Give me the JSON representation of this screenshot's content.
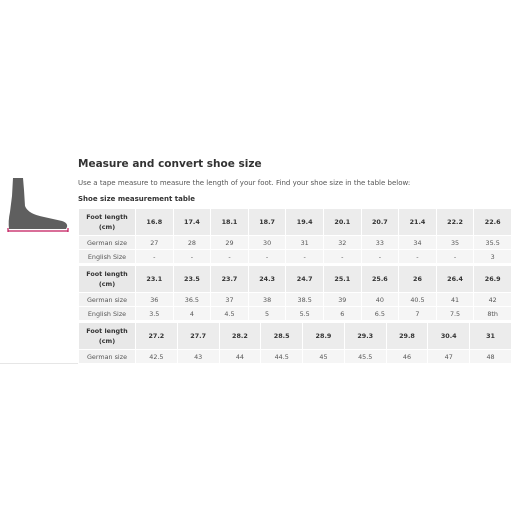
{
  "title": "Measure and convert shoe size",
  "intro": "Use a tape measure to measure the length of your foot. Find your shoe size in the table below:",
  "subtitle": "Shoe size measurement table",
  "labels": {
    "foot_length": "Foot length (cm)",
    "german": "German size",
    "english": "English Size"
  },
  "colors": {
    "foot": "#5f5f5f",
    "measure_line": "#c2185b"
  },
  "tables": [
    {
      "foot_length": [
        "16.8",
        "17.4",
        "18.1",
        "18.7",
        "19.4",
        "20.1",
        "20.7",
        "21.4",
        "22.2",
        "22.6"
      ],
      "german": [
        "27",
        "28",
        "29",
        "30",
        "31",
        "32",
        "33",
        "34",
        "35",
        "35.5"
      ],
      "english": [
        "-",
        "-",
        "-",
        "-",
        "-",
        "-",
        "-",
        "-",
        "-",
        "3"
      ]
    },
    {
      "foot_length": [
        "23.1",
        "23.5",
        "23.7",
        "24.3",
        "24.7",
        "25.1",
        "25.6",
        "26",
        "26.4",
        "26.9"
      ],
      "german": [
        "36",
        "36.5",
        "37",
        "38",
        "38.5",
        "39",
        "40",
        "40.5",
        "41",
        "42"
      ],
      "english": [
        "3.5",
        "4",
        "4.5",
        "5",
        "5.5",
        "6",
        "6.5",
        "7",
        "7.5",
        "8th"
      ]
    },
    {
      "foot_length": [
        "27.2",
        "27.7",
        "28.2",
        "28.5",
        "28.9",
        "29.3",
        "29.8",
        "30.4",
        "31"
      ],
      "german": [
        "42.5",
        "43",
        "44",
        "44.5",
        "45",
        "45.5",
        "46",
        "47",
        "48"
      ]
    }
  ]
}
